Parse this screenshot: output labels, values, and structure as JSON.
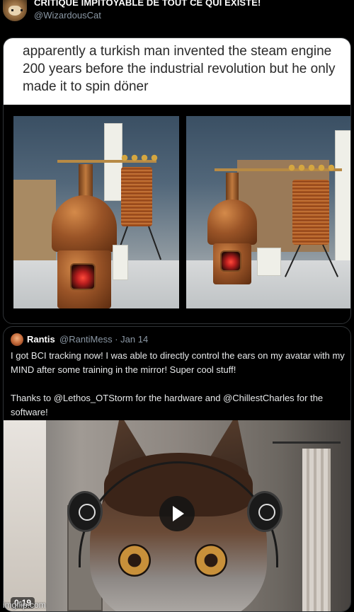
{
  "header": {
    "account_name": "CRITIQUE IMPITOYABLE DE TOUT CE QUI EXISTE!",
    "account_handle": "@WizardousCat"
  },
  "meme": {
    "caption": "apparently a turkish man invented the steam engine 200 years before the industrial revolution but he only made it to spin döner"
  },
  "quoted_tweet": {
    "author_name": "Rantis",
    "author_handle": "@RantiMess · Jan 14",
    "paragraph_1": "I got BCI tracking now! I was able to directly control the ears on my avatar with my MIND after some training in the mirror! Super cool stuff!",
    "paragraph_2": "Thanks to @Lethos_OTStorm for the hardware and @ChillestCharles for the software!",
    "video_duration": "0:19"
  },
  "watermark": "imgflip.com"
}
